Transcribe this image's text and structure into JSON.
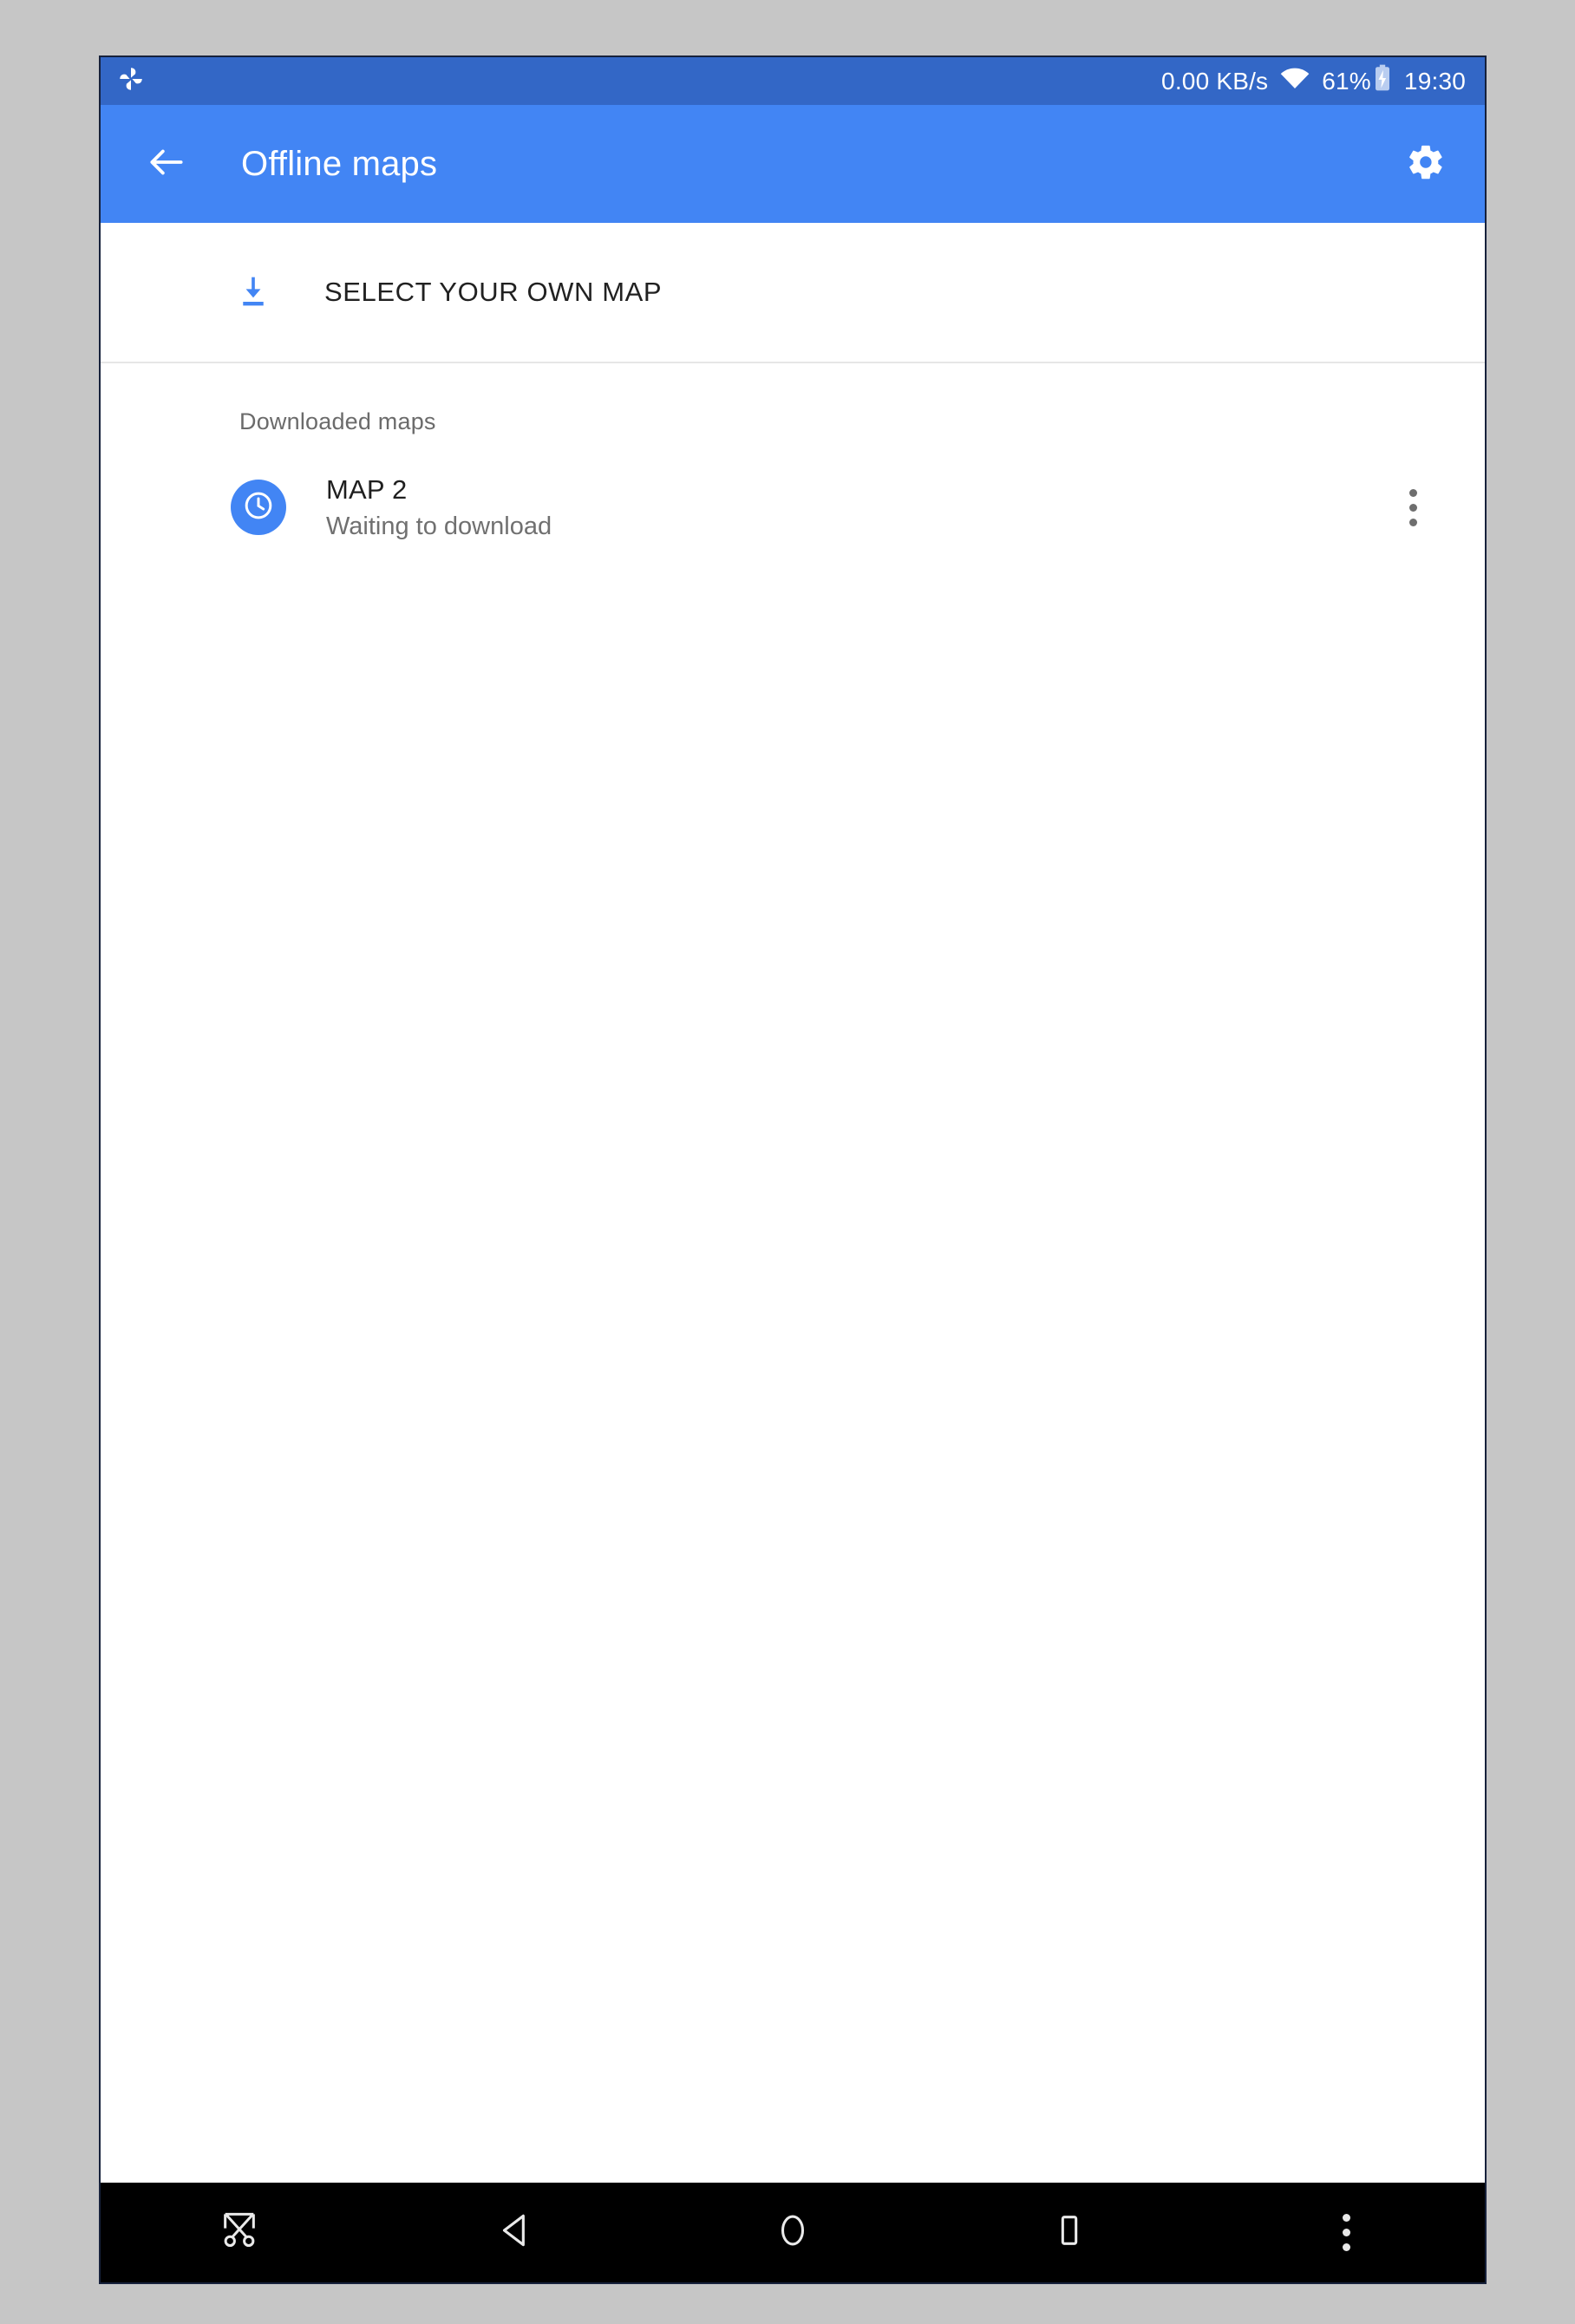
{
  "statusbar": {
    "app_icon": "pinwheel-icon",
    "network_speed": "0.00 KB/s",
    "wifi_icon": "wifi-icon",
    "battery_percent": "61%",
    "battery_icon": "battery-charging-icon",
    "clock": "19:30"
  },
  "appbar": {
    "back_icon": "back-arrow-icon",
    "title": "Offline maps",
    "settings_icon": "gear-icon"
  },
  "main": {
    "select_own_map": {
      "icon": "download-icon",
      "label": "SELECT YOUR OWN MAP"
    },
    "section_header": "Downloaded maps",
    "maps": [
      {
        "icon": "clock-icon",
        "title": "MAP 2",
        "status": "Waiting to download",
        "overflow_icon": "more-vert-icon"
      }
    ]
  },
  "navbar": {
    "buttons": [
      {
        "name": "screenshot-button",
        "icon": "scissors-icon"
      },
      {
        "name": "back-button",
        "icon": "triangle-back-icon"
      },
      {
        "name": "home-button",
        "icon": "circle-home-icon"
      },
      {
        "name": "recents-button",
        "icon": "square-recents-icon"
      },
      {
        "name": "more-button",
        "icon": "more-vert-icon"
      }
    ]
  },
  "colors": {
    "status_bar": "#3367c6",
    "app_bar": "#4285f4",
    "accent_blue": "#4285f4",
    "page_background": "#c6c6c6",
    "surface": "#ffffff",
    "nav_bar": "#000000",
    "divider": "#e6e6e6",
    "primary_text": "#212121",
    "secondary_text": "#707070"
  }
}
